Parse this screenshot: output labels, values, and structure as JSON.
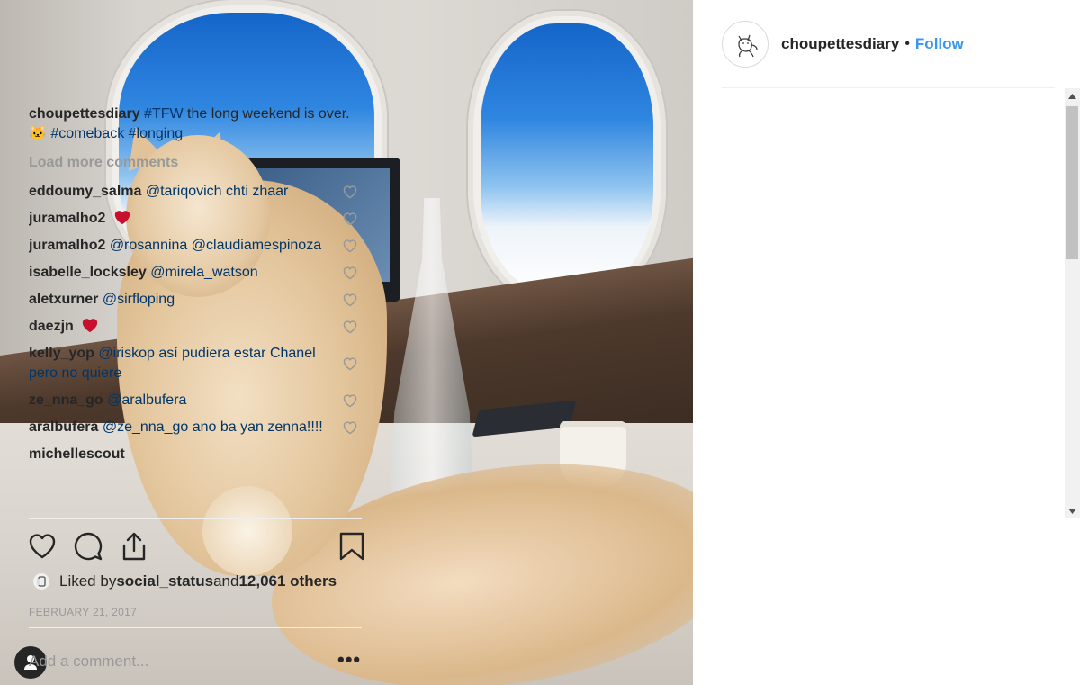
{
  "post": {
    "username": "choupettesdiary",
    "separator": "•",
    "follow_label": "Follow",
    "caption": {
      "username": "choupettesdiary",
      "tag1": "#TFW",
      "text1": " the long weekend is over. ",
      "emoji": "🐱",
      "tag2": "#comeback",
      "tag3": "#longing"
    },
    "load_more_label": "Load more comments",
    "comments": [
      {
        "user": "eddoumy_salma",
        "text": "@tariqovich chti zhaar"
      },
      {
        "user": "juramalho2",
        "text": ""
      },
      {
        "user": "juramalho2",
        "text": "@rosannina @claudiamespinoza"
      },
      {
        "user": "isabelle_locksley",
        "text": "@mirela_watson"
      },
      {
        "user": "aletxurner",
        "text": "@sirfloping"
      },
      {
        "user": "daezjn",
        "text": ""
      },
      {
        "user": "kelly_yop",
        "text": "@iriskop así pudiera estar Chanel pero no quiere"
      },
      {
        "user": "ze_nna_go",
        "text": "@aralbufera"
      },
      {
        "user": "aralbufera",
        "text": "@ze_nna_go ano ba yan zenna!!!!"
      },
      {
        "user": "michellescout",
        "text": ""
      }
    ],
    "likes": {
      "prefix": "Liked by ",
      "user": "social_status",
      "middle": " and ",
      "count": "12,061 others"
    },
    "date": "FEBRUARY 21, 2017",
    "comment_placeholder": "Add a comment...",
    "more_label": "•••"
  },
  "colors": {
    "link": "#3897f0",
    "hashtag": "#003569",
    "muted": "#999999",
    "heart_red": "#ed4956"
  },
  "icons": [
    "user-tag-icon",
    "heart-icon",
    "comment-icon",
    "share-icon",
    "bookmark-icon",
    "small-heart-icon",
    "red-heart-icon"
  ]
}
